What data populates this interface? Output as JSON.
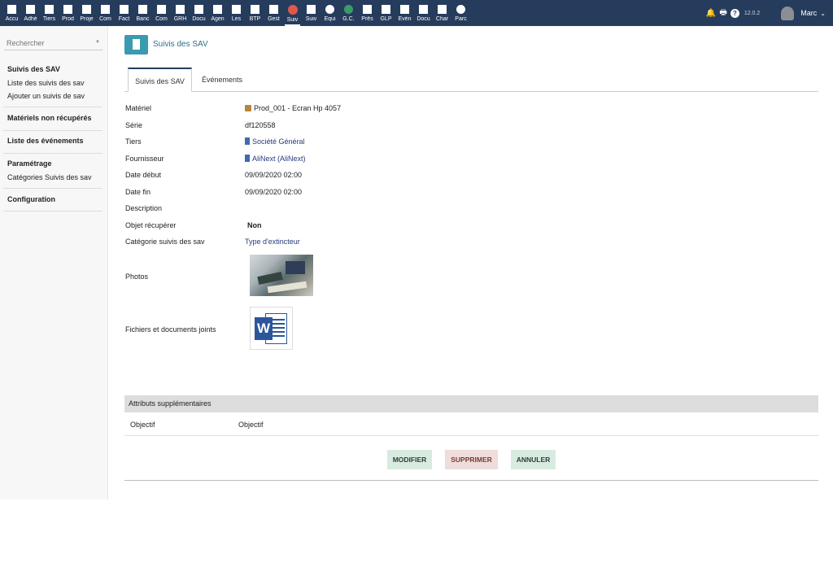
{
  "topmenu": {
    "items": [
      {
        "label": "Accu",
        "icon": "home-icon"
      },
      {
        "label": "Adhé",
        "icon": "users-icon"
      },
      {
        "label": "Tiers",
        "icon": "building-icon"
      },
      {
        "label": "Prod",
        "icon": "cube-icon"
      },
      {
        "label": "Proje",
        "icon": "sitemap-icon"
      },
      {
        "label": "Com",
        "icon": "briefcase-icon"
      },
      {
        "label": "Fact",
        "icon": "invoice-icon"
      },
      {
        "label": "Banc",
        "icon": "bank-icon"
      },
      {
        "label": "Com",
        "icon": "card-icon"
      },
      {
        "label": "GRH",
        "icon": "hr-icon"
      },
      {
        "label": "Docu",
        "icon": "folder-icon"
      },
      {
        "label": "Agen",
        "icon": "calendar-icon"
      },
      {
        "label": "Les",
        "icon": "wrench-icon"
      },
      {
        "label": "BTP",
        "icon": "btp-icon"
      },
      {
        "label": "Gest",
        "icon": "gest-icon"
      },
      {
        "label": "Suiv",
        "icon": "sav-icon"
      },
      {
        "label": "Suiv",
        "icon": "download-icon"
      },
      {
        "label": "Équi",
        "icon": "equipment-icon"
      },
      {
        "label": "G.C.",
        "icon": "globe-icon"
      },
      {
        "label": "Prês",
        "icon": "loan-icon"
      },
      {
        "label": "GLP",
        "icon": "glp-icon"
      },
      {
        "label": "Évén",
        "icon": "ticket-icon"
      },
      {
        "label": "Docu",
        "icon": "document-icon"
      },
      {
        "label": "Char",
        "icon": "chart-icon"
      },
      {
        "label": "Parc",
        "icon": "park-icon"
      }
    ],
    "active_index": 15
  },
  "topright": {
    "version": "12.0.2",
    "user_name": "Marc",
    "bell_glyph": "🔔",
    "print_glyph": "🖶",
    "help_glyph": "?",
    "caret_glyph": "⌄"
  },
  "sidebar": {
    "search_placeholder": "Rechercher",
    "dropdown_glyph": "▼",
    "section_sav": "Suivis des SAV",
    "link_list": "Liste des suivis des sav",
    "link_add": "Ajouter un suivis de sav",
    "section_materials": "Matériels non récupérés",
    "section_events": "Liste des événements",
    "section_settings": "Paramétrage",
    "link_categories": "Catégories Suivis des sav",
    "section_config": "Configuration"
  },
  "page": {
    "title": "Suivis des SAV",
    "tabs": [
      "Suivis des SAV",
      "Événements"
    ]
  },
  "fields": {
    "materiel_label": "Matériel",
    "materiel_value": "Prod_001 - Ecran Hp 4057",
    "serie_label": "Série",
    "serie_value": "df120558",
    "tiers_label": "Tiers",
    "tiers_value": "Société Général",
    "fournisseur_label": "Fournisseur",
    "fournisseur_value": "AliNext (AliNext)",
    "date_debut_label": "Date début",
    "date_debut_value": "09/09/2020 02:00",
    "date_fin_label": "Date fin",
    "date_fin_value": "09/09/2020 02:00",
    "description_label": "Description",
    "objet_label": "Objet récupérer",
    "objet_value": "Non",
    "categorie_label": "Catégorie suivis des sav",
    "categorie_value": "Type d'extincteur",
    "photos_label": "Photos",
    "files_label": "Fichiers et documents joints",
    "word_letter": "W"
  },
  "attributes": {
    "header": "Attributs supplémentaires",
    "key": "Objectif",
    "value": "Objectif"
  },
  "actions": {
    "modify": "MODIFIER",
    "delete": "SUPPRIMER",
    "cancel": "ANNULER"
  },
  "colors": {
    "topbar": "#263c5c",
    "accent": "#3a9bb0",
    "link": "#263c7c",
    "button_green": "#d8ebe0",
    "button_red": "#eedddb"
  }
}
